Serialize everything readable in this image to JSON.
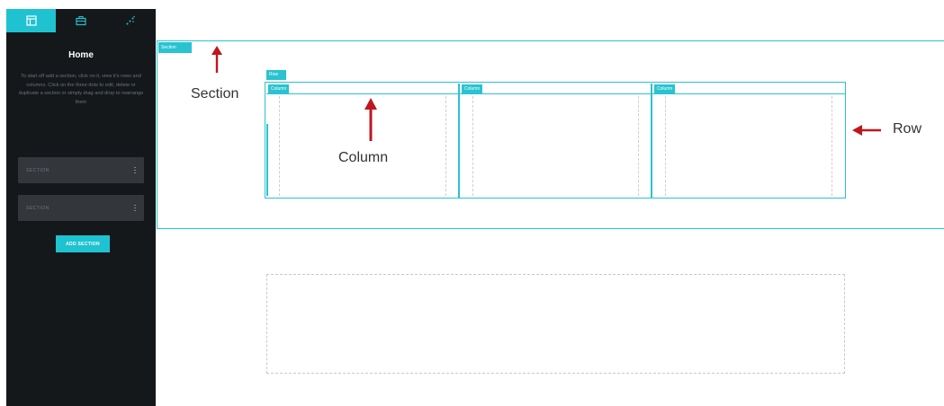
{
  "sidebar": {
    "tabs": [
      {
        "icon": "layout-icon",
        "active": true
      },
      {
        "icon": "briefcase-icon",
        "active": false
      },
      {
        "icon": "sparkle-icon",
        "active": false
      }
    ],
    "title": "Home",
    "description": "To start off add a section, click on it, view it's rows and columns. Click on the three dots to edit, delete or duplicate a section or simply drag and drop to rearrange them",
    "items": [
      {
        "label": "SECTION"
      },
      {
        "label": "SECTION"
      }
    ],
    "add_section_label": "ADD SECTION"
  },
  "canvas": {
    "section_tag": "Section",
    "row_tag": "Row",
    "columns": [
      {
        "tag": "Column"
      },
      {
        "tag": "Column"
      },
      {
        "tag": "Column"
      }
    ]
  },
  "annotations": {
    "section": "Section",
    "column": "Column",
    "row": "Row"
  },
  "colors": {
    "accent": "#29c3d1",
    "sidebar_bg": "#15181b",
    "sidebar_item_bg": "#33373c",
    "annotation_arrow": "#c0161c"
  }
}
